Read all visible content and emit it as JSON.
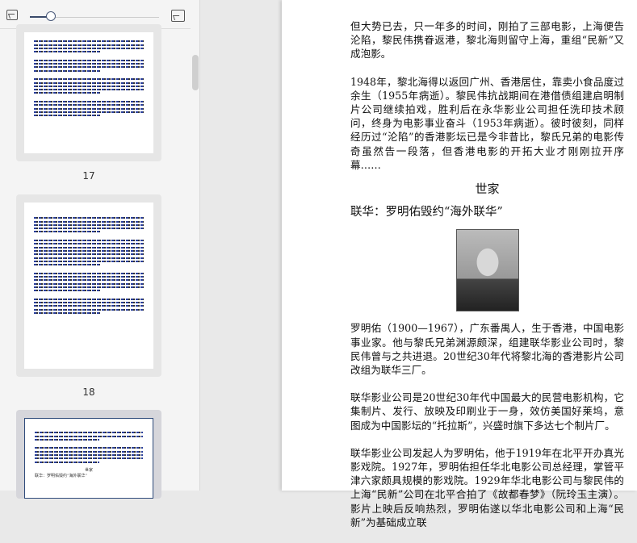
{
  "sidebar": {
    "thumbnails": [
      {
        "page_label": "17"
      },
      {
        "page_label": "18"
      },
      {
        "page_label": "",
        "heading": "世家",
        "subheading": "联华：罗明佑毁约“海外联华”"
      }
    ]
  },
  "document": {
    "paragraphs_top": [
      "但大势已去，只一年多的时间，刚拍了三部电影，上海便告沦陷，黎民伟携眷返港，黎北海则留守上海，重组“民新”又成泡影。",
      "1948年，黎北海得以返回广州、香港居住，靠卖小食品度过余生（1955年病逝）。黎民伟抗战期间在港借债组建启明制片公司继续拍戏，胜利后在永华影业公司担任洗印技术顾问，终身为电影事业奋斗（1953年病逝）。彼时彼刻，同样经历过“沦陷”的香港影坛已是今非昔比，黎氏兄弟的电影传奇虽然告一段落，但香港电影的开拓大业才刚刚拉开序幕……"
    ],
    "section_title": "世家",
    "article_title": "联华：罗明佑毁约“海外联华”",
    "paragraphs_bottom": [
      "罗明佑（1900—1967），广东番禺人，生于香港，中国电影事业家。他与黎氏兄弟渊源颇深，组建联华影业公司时，黎民伟曾与之共进退。20世纪30年代将黎北海的香港影片公司改组为联华三厂。",
      "联华影业公司是20世纪30年代中国最大的民营电影机构，它集制片、发行、放映及印刷业于一身，效仿美国好莱坞，意图成为中国影坛的“托拉斯”，兴盛时旗下多达七个制片厂。",
      "联华影业公司发起人为罗明佑，他于1919年在北平开办真光影戏院。1927年，罗明佑担任华北电影公司总经理，掌管平津六家颇具规模的影戏院。1929年华北电影公司与黎民伟的上海“民新”公司在北平合拍了《故都春梦》（阮玲玉主演）。影片上映后反响热烈，罗明佑遂以华北电影公司和上海“民新”为基础成立联"
    ]
  }
}
